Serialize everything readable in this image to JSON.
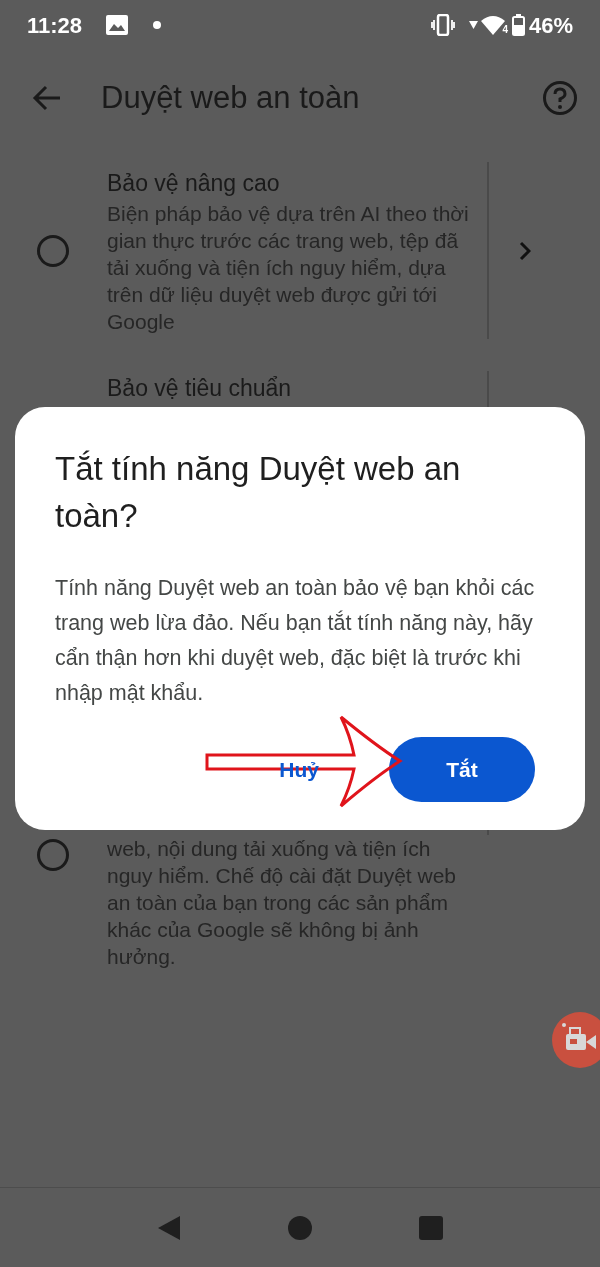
{
  "status_bar": {
    "time": "11:28",
    "wifi_badge": "4",
    "battery": "46%"
  },
  "toolbar": {
    "title": "Duyệt web an toàn"
  },
  "options": [
    {
      "title": "Bảo vệ nâng cao",
      "description": "Biện pháp bảo vệ dựa trên AI theo thời gian thực trước các trang web, tệp đã tải xuống và tiện ích nguy hiểm, dựa trên dữ liệu duyệt web được gửi tới Google",
      "selected": false,
      "chevron": true,
      "divider": true
    },
    {
      "title": "Bảo vệ tiêu chuẩn",
      "divider": true
    },
    {
      "description": "web, nội dung tải xuống và tiện ích nguy hiểm. Chế độ cài đặt Duyệt web an toàn của bạn trong các sản phẩm khác của Google sẽ không bị ảnh hưởng.",
      "selected": false
    }
  ],
  "dialog": {
    "title": "Tắt tính năng Duyệt web an toàn?",
    "body": "Tính năng Duyệt web an toàn bảo vệ bạn khỏi các trang web lừa đảo. Nếu bạn tắt tính năng này, hãy cẩn thận hơn khi duyệt web, đặc biệt là trước khi nhập mật khẩu.",
    "buttons": [
      {
        "label": "Huỷ",
        "kind": "text"
      },
      {
        "label": "Tắt",
        "kind": "filled"
      }
    ]
  }
}
